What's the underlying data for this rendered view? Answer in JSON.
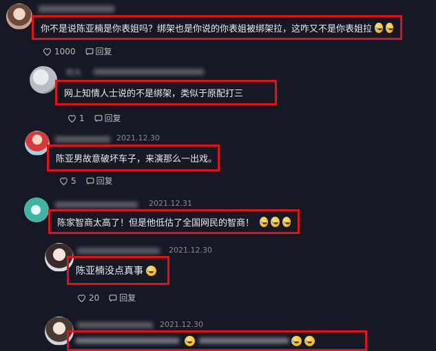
{
  "comments": [
    {
      "text": "你不是说陈亚楠是你表姐吗？绑架也是你说的你表姐被绑架拉，这咋又不是你表姐拉",
      "emojis": [
        "laughing-crying-emoji",
        "laughing-crying-emoji"
      ],
      "likes": "1000",
      "reply_label": "回复"
    },
    {
      "username": "阳光",
      "text": "网上知情人士说的不是绑架，类似于原配打三",
      "likes": "1",
      "reply_label": "回复"
    },
    {
      "date": "2021.12.30",
      "text": "陈亚男故意破坏车子，来演那么一出戏。",
      "likes": "5",
      "reply_label": "回复"
    },
    {
      "date": "2021.12.31",
      "text": "陈家智商太高了！但是他低估了全国网民的智商！",
      "emojis": [
        "laughing-crying-emoji",
        "laughing-crying-emoji",
        "laughing-crying-emoji"
      ],
      "reply_label": "回复"
    },
    {
      "date": "2021.12.30",
      "text": "陈亚楠没点真事",
      "emojis": [
        "laughing-crying-emoji"
      ],
      "likes": "20",
      "reply_label": "回复"
    },
    {
      "date": "2021.12.30"
    }
  ],
  "colors": {
    "background": "#161823",
    "highlight_border": "#e5101f",
    "text": "#ececee",
    "meta": "#8a8b94"
  }
}
